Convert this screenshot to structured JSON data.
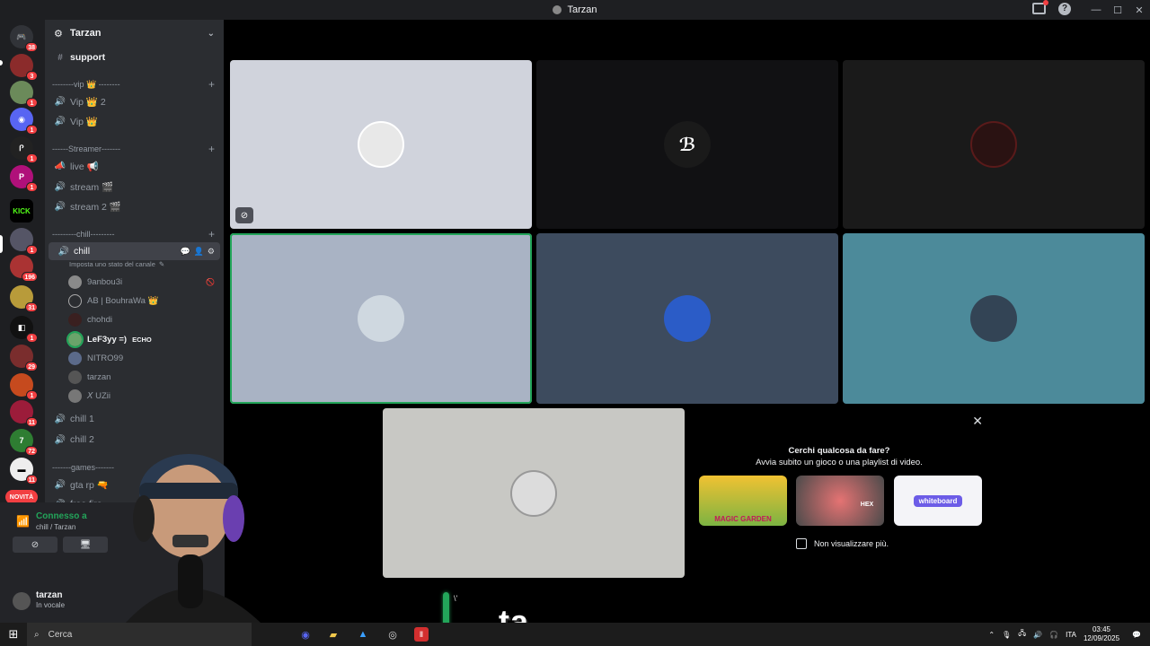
{
  "window": {
    "title": "Tarzan"
  },
  "server": {
    "name": "Tarzan"
  },
  "channels": {
    "support": "support",
    "cat_vip": "--------vip 👑 --------",
    "vip_2": "Vip 👑 2",
    "vip": "Vip 👑",
    "cat_streamer": "------Streamer-------",
    "live": "live 📢",
    "stream": "stream 🎬",
    "stream_2": "stream 2 🎬",
    "cat_chill": "---------chill---------",
    "chill": "chill",
    "chill_status": "Imposta uno stato del canale",
    "chill_1": "chill 1",
    "chill_2": "chill 2",
    "cat_games": "-------games-------",
    "gta": "gta rp 🔫",
    "free_fire": "free fire"
  },
  "voice_users": [
    {
      "name": "9anbou3i",
      "color": "#8a8a8a"
    },
    {
      "name": "AB | BouhraWa 👑",
      "color": "#2b2d31"
    },
    {
      "name": "chohdi",
      "color": "#3a2020"
    },
    {
      "name": "LeF3yy =)",
      "extra": "ECHO",
      "color": "#6aa46a"
    },
    {
      "name": "NITRO99",
      "color": "#5b6a8a"
    },
    {
      "name": "tarzan",
      "color": "#555"
    },
    {
      "name": "𝘟 UZii",
      "color": "#777"
    }
  ],
  "rail_badges": [
    "38",
    "3",
    "1",
    "1",
    "1",
    "1",
    "1",
    "1",
    "1",
    "1",
    "196",
    "31",
    "1",
    "29",
    "1",
    "11",
    "72",
    "11"
  ],
  "rail_new": "NOVITÀ",
  "rail_kick": "KICK",
  "voice_panel": {
    "status": "Connesso a",
    "location": "chill / Tarzan"
  },
  "user_panel": {
    "name": "tarzan",
    "status": "In vocale"
  },
  "activity": {
    "question": "Cerchi qualcosa da fare?",
    "subtitle": "Avvia subito un gioco o una playlist di video.",
    "tile_1": "MAGIC GARDEN",
    "tile_2": "HEX",
    "tile_3": "whiteboard",
    "dont_show": "Non visualizzare più."
  },
  "caption": "ta",
  "taskbar": {
    "search": "Cerca",
    "lang": "ITA",
    "time": "03:45",
    "date": "12/09/2025"
  },
  "colors": {
    "accent_green": "#23a55a",
    "danger_red": "#f23f42",
    "sidebar_bg": "#2b2d31"
  }
}
